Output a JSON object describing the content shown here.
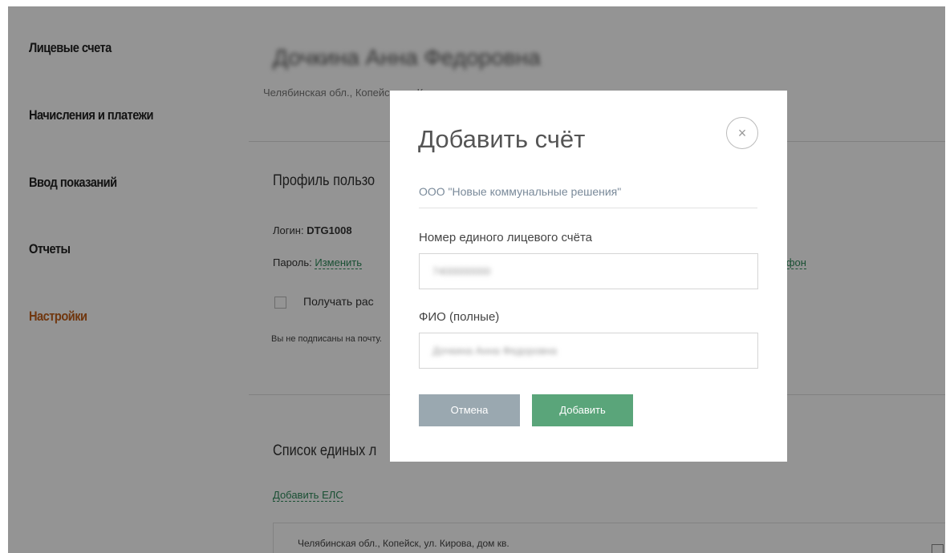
{
  "sidebar": {
    "items": [
      {
        "label": "Лицевые счета"
      },
      {
        "label": "Начисления и платежи"
      },
      {
        "label": "Ввод показаний"
      },
      {
        "label": "Отчеты"
      },
      {
        "label": "Настройки",
        "active": true
      }
    ]
  },
  "main": {
    "user_name": "Дочкина Анна Федоровна",
    "address": "Челябинская обл., Копейск, ул. Кирова, дом",
    "profile_title": "Профиль пользо",
    "login_label": "Логин:",
    "login_value": "DTG1008",
    "password_label": "Пароль:",
    "password_link": "Изменить",
    "phone_link": "лефон",
    "subscribe_label": "Получать рас",
    "not_subscribed_text": "Вы не подписаны на почту.",
    "els_title": "Список единых л",
    "add_els_link": "Добавить ЕЛС",
    "els_card_address": "Челябинская обл., Копейск, ул. Кирова, дом кв."
  },
  "modal": {
    "title": "Добавить счёт",
    "close_symbol": "×",
    "company": "ООО \"Новые коммунальные решения\"",
    "account_label": "Номер единого лицевого счёта",
    "account_value": "7400000000",
    "fio_label": "ФИО (полные)",
    "fio_value": "Дочкина Анна Федоровна",
    "cancel_label": "Отмена",
    "add_label": "Добавить"
  },
  "colors": {
    "accent_active": "#c15f1a",
    "link": "#2d8a5a",
    "add_button": "#5aa57a",
    "cancel_button": "#9aa8b0"
  }
}
